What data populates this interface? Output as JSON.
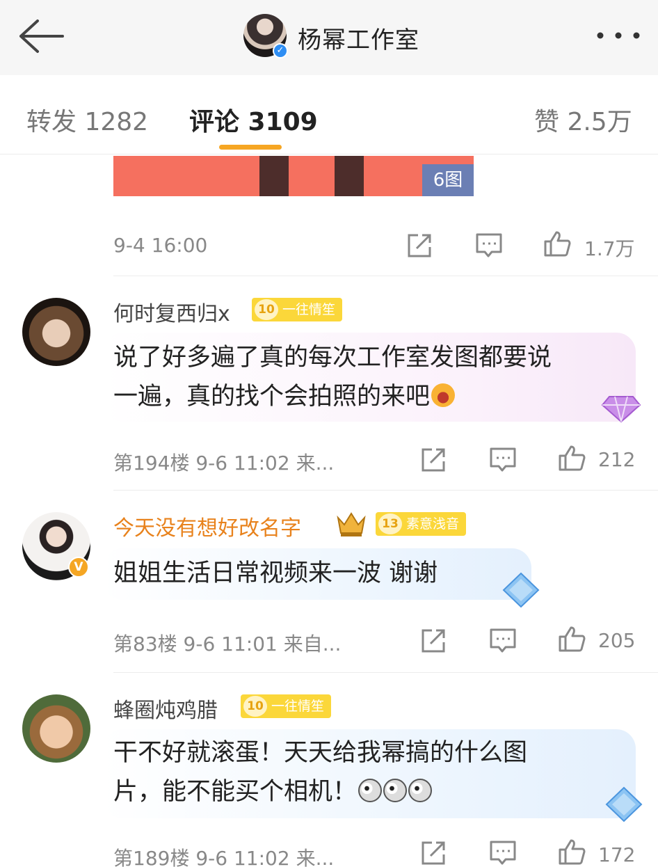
{
  "header": {
    "title": "杨幂工作室",
    "back_icon": "arrow-left-icon",
    "more_icon": "more-dots-icon"
  },
  "tabs": [
    {
      "label": "转发 1282",
      "active": false
    },
    {
      "label": "评论 3109",
      "active": true
    },
    {
      "label": "赞 2.5万",
      "active": false
    }
  ],
  "post": {
    "image_count": "6图",
    "timestamp": "9-4 16:00",
    "likes": "1.7万"
  },
  "comments": [
    {
      "username": "何时复西归x",
      "fan_level": "10",
      "fan_title": "一往情笙",
      "text_line1": "说了好多遍了真的每次工作室发图都要说",
      "text_line2": "一遍，真的找个会拍照的来吧",
      "meta": "第194楼 9-6 11:02 来...",
      "likes": "212"
    },
    {
      "username": "今天没有想好改名字",
      "fan_level": "13",
      "fan_title": "素意浅音",
      "verified": "V",
      "text_line1": "姐姐生活日常视频来一波 谢谢",
      "meta": "第83楼 9-6 11:01 来自...",
      "likes": "205"
    },
    {
      "username": "蜂圈炖鸡腊",
      "fan_level": "10",
      "fan_title": "一往情笙",
      "text_line1": "干不好就滚蛋！天天给我幂搞的什么图",
      "text_line2": "片，能不能买个相机！",
      "meta": "第189楼 9-6 11:02 来...",
      "likes": "172"
    }
  ],
  "colors": {
    "accent": "#f6a623",
    "gold_username": "#e8821c",
    "meta_gray": "#888888"
  }
}
